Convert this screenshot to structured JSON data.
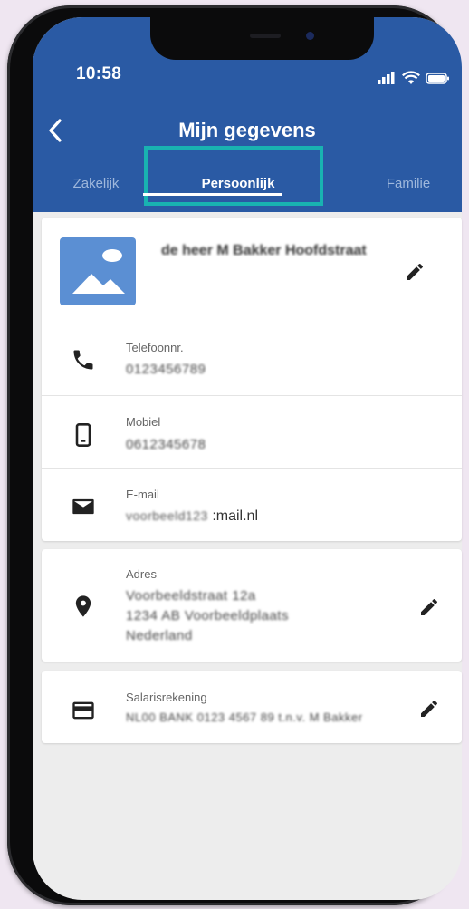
{
  "status_bar": {
    "time": "10:58"
  },
  "header": {
    "title": "Mijn gegevens",
    "tabs": [
      {
        "label": "Zakelijk",
        "active": false
      },
      {
        "label": "Persoonlijk",
        "active": true
      },
      {
        "label": "Familie",
        "active": false
      }
    ]
  },
  "profile": {
    "name": "de heer M Bakker Hoofdstraat"
  },
  "contact": {
    "phone": {
      "label": "Telefoonnr.",
      "value": "0123456789"
    },
    "mobile": {
      "label": "Mobiel",
      "value": "0612345678"
    },
    "email": {
      "label": "E-mail",
      "value_blurred": "voorbeeld123",
      "value_suffix": ":mail.nl"
    }
  },
  "address": {
    "label": "Adres",
    "line1": "Voorbeeldstraat 12a",
    "line2": "1234 AB Voorbeeldplaats",
    "line3": "Nederland"
  },
  "bank": {
    "label": "Salarisrekening",
    "value": "NL00 BANK 0123 4567 89 t.n.v. M Bakker"
  },
  "colors": {
    "header": "#2a5aa4",
    "highlight": "#19b3b1",
    "avatar": "#5b8fd3"
  }
}
